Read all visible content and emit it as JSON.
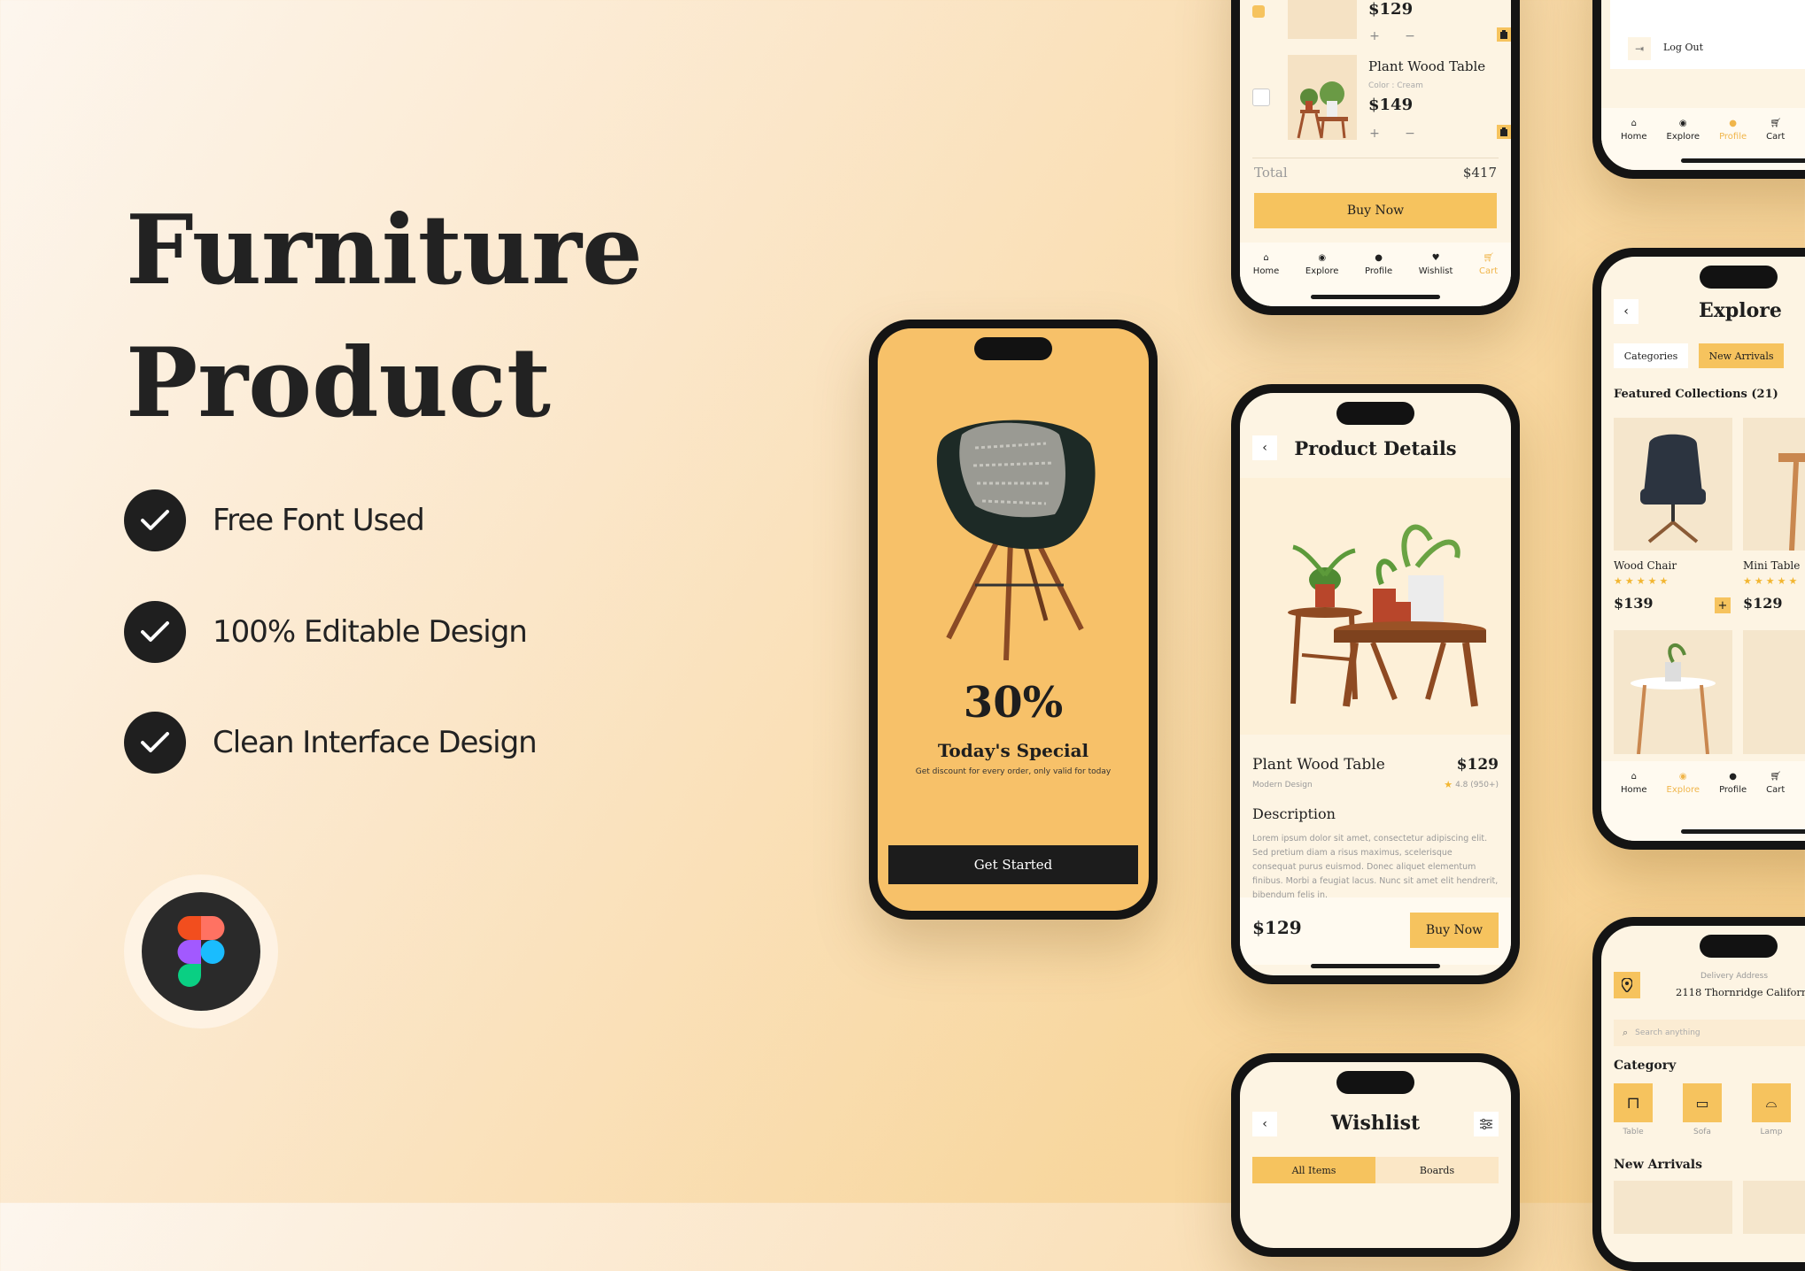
{
  "hero": {
    "title_line1": "Furniture",
    "title_line2": "Product",
    "features": [
      "Free Font Used",
      "100% Editable Design",
      "Clean Interface Design"
    ]
  },
  "colors": {
    "accent": "#f6c35e",
    "dark": "#1f1f1f",
    "cream": "#fdf4e3"
  },
  "nav": {
    "home": "Home",
    "explore": "Explore",
    "profile": "Profile",
    "wishlist": "Wishlist",
    "cart": "Cart"
  },
  "splash": {
    "discount": "30%",
    "title": "Today's Special",
    "subtitle": "Get discount for every order, only valid for today",
    "cta": "Get Started"
  },
  "cart": {
    "item1_price": "$129",
    "item2_name": "Plant Wood Table",
    "item2_color": "Color : Cream",
    "item2_price": "$149",
    "total_label": "Total",
    "total_value": "$417",
    "buy": "Buy Now"
  },
  "product": {
    "header": "Product Details",
    "name": "Plant Wood Table",
    "price": "$129",
    "category": "Modern Design",
    "rating": "4.8 (950+)",
    "desc_title": "Description",
    "desc": "Lorem ipsum dolor sit amet, consectetur adipiscing elit. Sed pretium diam a risus maximus, scelerisque consequat purus euismod. Donec aliquet elementum finibus. Morbi a feugiat lacus. Nunc sit amet elit hendrerit, bibendum felis in.",
    "footer_price": "$129",
    "buy": "Buy Now"
  },
  "wishlist": {
    "header": "Wishlist",
    "tab_all": "All Items",
    "tab_boards": "Boards"
  },
  "profile": {
    "logout": "Log Out"
  },
  "explore": {
    "header": "Explore",
    "chip_categories": "Categories",
    "chip_new": "New Arrivals",
    "featured": "Featured Collections (21)",
    "item1_name": "Wood Chair",
    "item1_price": "$139",
    "item2_name": "Mini Table",
    "item2_price": "$129"
  },
  "home": {
    "delivery_label": "Delivery Address",
    "address": "2118 Thornridge Californ",
    "search_placeholder": "Search anything",
    "category_title": "Category",
    "cat_table": "Table",
    "cat_sofa": "Sofa",
    "cat_lamp": "Lamp",
    "new_arrivals": "New Arrivals"
  }
}
